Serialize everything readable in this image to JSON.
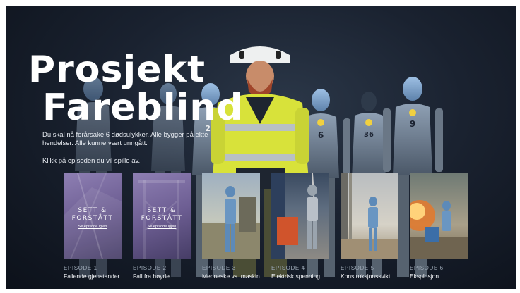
{
  "title": {
    "line1": "Prosjekt",
    "line2": "Fareblind"
  },
  "description": "Du skal nå forårsake 6 dødsulykker. Alle bygger på ekte hendelser. Alle kunne vært unngått.",
  "instruction": "Klikk på episoden du vil spille av.",
  "overlay": {
    "heading": "SETT & FORSTÅTT",
    "link": "Se episode igjen"
  },
  "episodes": [
    {
      "number": "EPISODE 1",
      "name": "Fallende gjenstander",
      "watched": true
    },
    {
      "number": "EPISODE 2",
      "name": "Fall fra høyde",
      "watched": true
    },
    {
      "number": "EPISODE 3",
      "name": "Menneske vs. maskin",
      "watched": false
    },
    {
      "number": "EPISODE 4",
      "name": "Elektrisk spenning",
      "watched": false
    },
    {
      "number": "EPISODE 5",
      "name": "Konstruksjonssvikt",
      "watched": false
    },
    {
      "number": "EPISODE 6",
      "name": "Eksplosjon",
      "watched": false
    }
  ],
  "dummy_numbers": [
    "25",
    "6",
    "36",
    "9"
  ],
  "colors": {
    "hi_vis_yellow": "#d8e23a",
    "dummy_blue": "#7fa2c8",
    "watched_overlay": "#7a6ba0",
    "background": "#141b26"
  }
}
